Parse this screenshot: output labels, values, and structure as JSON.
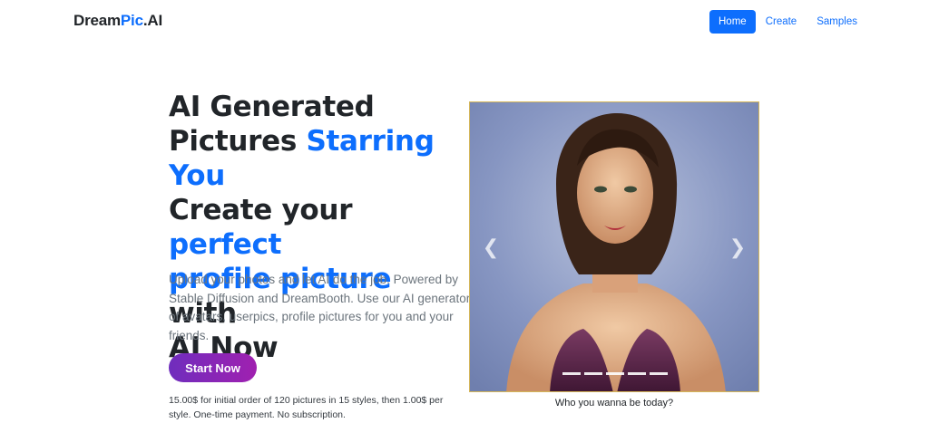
{
  "brand": {
    "prefix": "Dream",
    "accent": "Pic",
    "suffix": ".AI"
  },
  "nav": {
    "home": "Home",
    "create": "Create",
    "samples": "Samples"
  },
  "hero": {
    "line1": "AI Generated",
    "line2a": "Pictures ",
    "line2b": "Starring You",
    "line3a": "Create your ",
    "line3b": "perfect",
    "line4a": "profile picture",
    "line4b": " with",
    "line5": "AI Now",
    "lead": "Upload your photos and let AI do the job. Powered by Stable Diffusion and DreamBooth. Use our AI generator of avatars, userpics, profile pictures for you and your friends.",
    "cta": "Start Now",
    "note": "15.00$ for initial order of 120 pictures in 15 styles, then 1.00$ per style. One-time payment. No subscription."
  },
  "carousel": {
    "caption": "Who you wanna be today?",
    "prev_icon": "chevron-left-icon",
    "next_icon": "chevron-right-icon",
    "indicator_count": 5,
    "active_slide": 1
  },
  "colors": {
    "primary": "#0d6efd",
    "cta_gradient_start": "#6f2dbd",
    "cta_gradient_end": "#a020b0",
    "text_dark": "#212529",
    "text_muted": "#6c757d"
  }
}
